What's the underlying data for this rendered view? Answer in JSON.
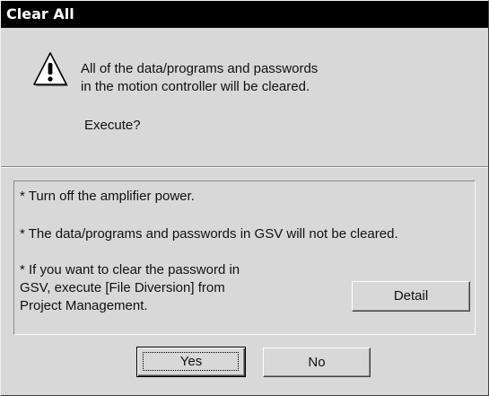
{
  "window": {
    "title": "Clear All"
  },
  "message": {
    "icon": "warning-icon",
    "line1": "All of the data/programs and passwords",
    "line2": "in the motion controller will be cleared.",
    "prompt": "Execute?"
  },
  "notes": {
    "note1": "* Turn off the amplifier power.",
    "note2": "* The data/programs and passwords in GSV will not be cleared.",
    "note3_line1": "* If you want to clear the password in",
    "note3_line2": "GSV, execute [File Diversion] from",
    "note3_line3": "Project Management.",
    "detail_label": "Detail"
  },
  "buttons": {
    "yes_label": "Yes",
    "no_label": "No"
  }
}
